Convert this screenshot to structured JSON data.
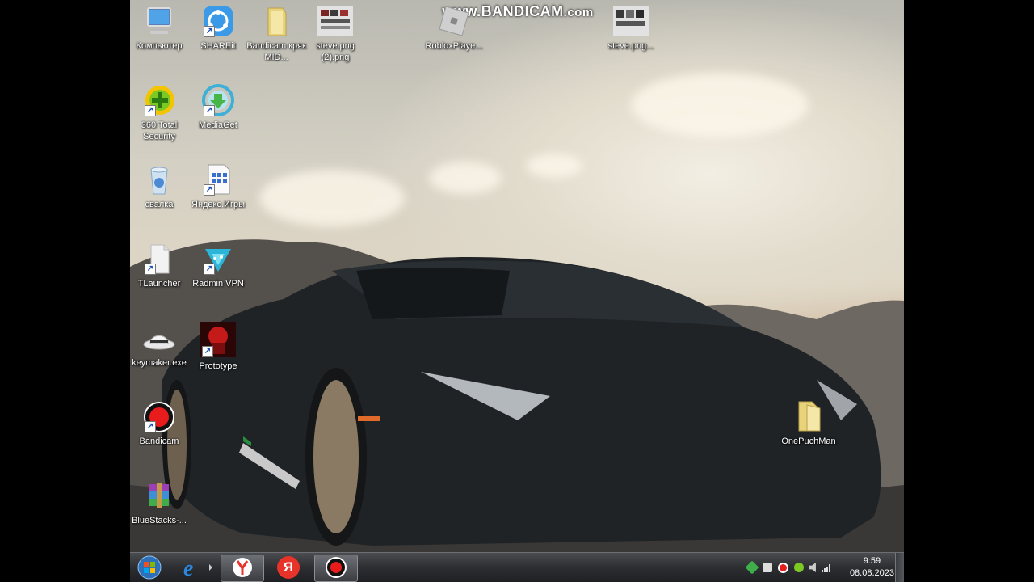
{
  "watermark": {
    "main": "www.BANDICAM",
    "suffix": ".com"
  },
  "desktop_icons": [
    {
      "label": "Компьютер"
    },
    {
      "label": "SHAREit"
    },
    {
      "label": "Bandicam кряк MID..."
    },
    {
      "label": "steve.png (2).png"
    },
    {
      "label": "RobloxPlaye..."
    },
    {
      "label": "steve.png..."
    },
    {
      "label": "360 Total Security"
    },
    {
      "label": "MediaGet"
    },
    {
      "label": "свалка"
    },
    {
      "label": "Яндекс.Игры"
    },
    {
      "label": "TLauncher"
    },
    {
      "label": "Radmin VPN"
    },
    {
      "label": "keymaker.exe"
    },
    {
      "label": "Prototype"
    },
    {
      "label": "Bandicam"
    },
    {
      "label": "BlueStacks-..."
    },
    {
      "label": "OnePuchMan"
    }
  ],
  "taskbar": {
    "yandex_letter": "Я",
    "clock_time": "9:59",
    "clock_date": "08.08.2023"
  },
  "colors": {
    "taskbar": "#2c2e32",
    "bandicam_red": "#e81c1c",
    "yandex_red": "#e8332a"
  }
}
